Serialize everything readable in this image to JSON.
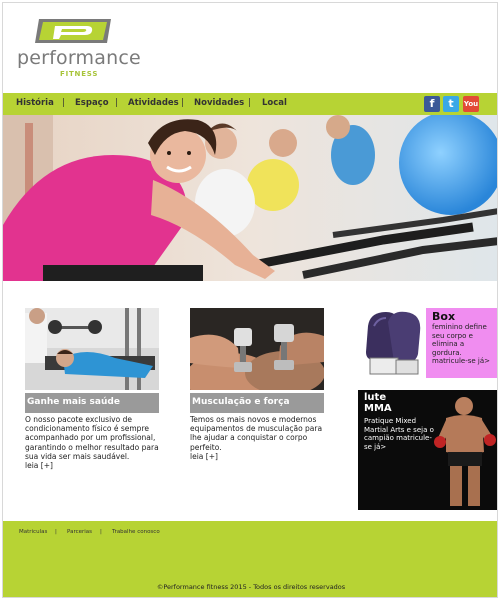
{
  "brand": {
    "name": "performance",
    "sub": "FITNESS",
    "accent": "#b7d334"
  },
  "nav": {
    "items": [
      {
        "label": "História"
      },
      {
        "label": "Espaço"
      },
      {
        "label": "Atividades"
      },
      {
        "label": "Novidades"
      },
      {
        "label": "Local"
      }
    ],
    "separator": "|",
    "social": {
      "facebook": "f",
      "twitter": "t",
      "youtube": "You"
    }
  },
  "cards": [
    {
      "title": "Ganhe mais saúde",
      "text": "O nosso pacote exclusivo de condicionamento físico é sempre acompanhado por um profissional, garantindo o melhor resultado para sua vida ser mais saudável.",
      "more": "leia [+]"
    },
    {
      "title": "Musculação e força",
      "text": "Temos os mais novos e modernos equipamentos de musculação para lhe ajudar a conquistar o corpo perfeito.",
      "more": "leia [+]"
    }
  ],
  "ads": {
    "box": {
      "title": "Box",
      "text": "feminino define seu corpo e elimina a gordura. matricule-se já>"
    },
    "mma": {
      "title_line1": "lute",
      "title_line2": "MMA",
      "text": "Pratique Mixed Martial Arts e seja o campião matricule-se já>"
    }
  },
  "footer": {
    "links": [
      {
        "label": "Matriculas"
      },
      {
        "label": "Parcerias"
      },
      {
        "label": "Trabalhe conosco"
      }
    ],
    "separator": "|",
    "copyright": "©Performance fitness 2015 - Todos os direitos reservados"
  }
}
